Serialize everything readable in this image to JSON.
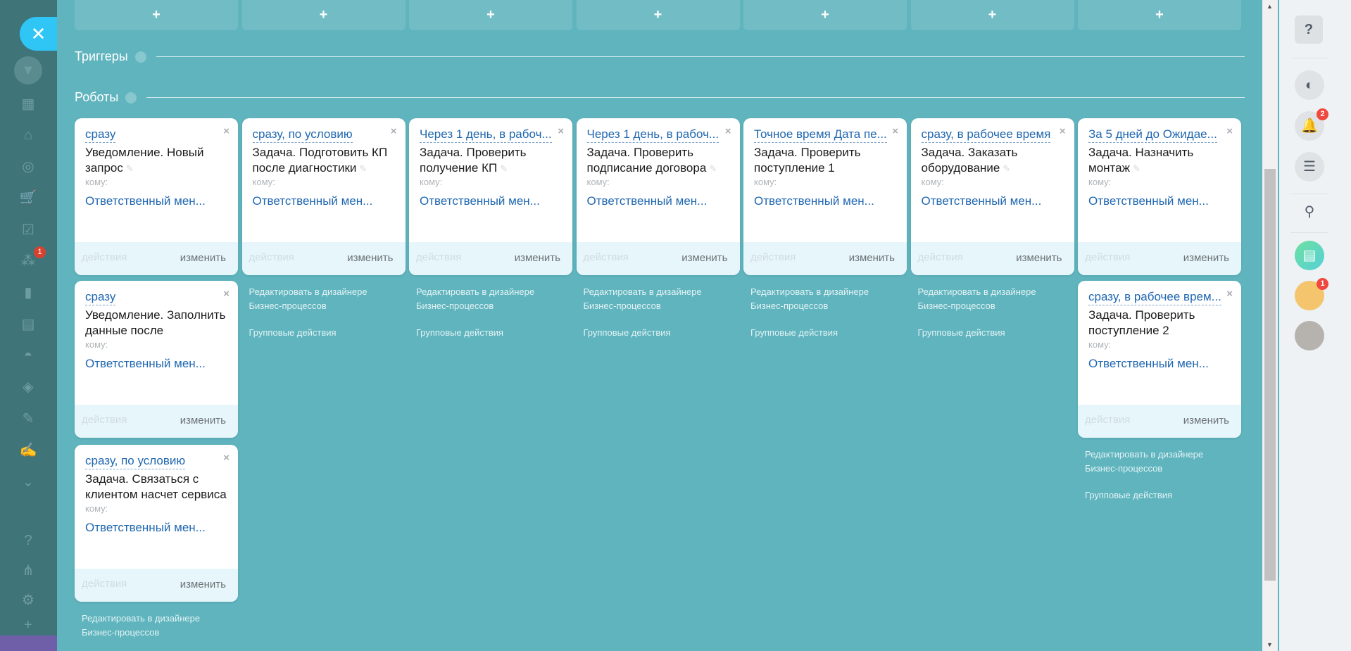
{
  "sidebar": {
    "close_label": "✕",
    "items": [
      {
        "icon": "filter-icon",
        "glyph": "▼",
        "active": true
      },
      {
        "icon": "calendar-list-icon",
        "glyph": "▦"
      },
      {
        "icon": "warehouse-icon",
        "glyph": "⌂"
      },
      {
        "icon": "target-icon",
        "glyph": "◎"
      },
      {
        "icon": "cart-icon",
        "glyph": "🛒"
      },
      {
        "icon": "checkbox-icon",
        "glyph": "☑"
      },
      {
        "icon": "network-icon",
        "glyph": "⁂",
        "badge": "1"
      },
      {
        "icon": "chart-icon",
        "glyph": "▮"
      },
      {
        "icon": "contact-card-icon",
        "glyph": "▤"
      },
      {
        "icon": "robot-icon",
        "glyph": "◓"
      },
      {
        "icon": "cube-icon",
        "glyph": "◈"
      },
      {
        "icon": "document-edit-icon",
        "glyph": "✎"
      },
      {
        "icon": "signature-icon",
        "glyph": "✍"
      },
      {
        "icon": "chevron-down-circle-icon",
        "glyph": "⌄"
      },
      {
        "icon": "help-icon",
        "glyph": "?"
      },
      {
        "icon": "sitemap-icon",
        "glyph": "⋔"
      },
      {
        "icon": "gear-icon",
        "glyph": "⚙"
      },
      {
        "icon": "plus-icon",
        "glyph": "+"
      }
    ]
  },
  "add_tiles": [
    "+",
    "+",
    "+",
    "+",
    "+",
    "+",
    "+"
  ],
  "sections": {
    "triggers": "Триггеры",
    "robots": "Роботы",
    "help": "?"
  },
  "card_labels": {
    "to": "кому:",
    "actions": "действия",
    "change": "изменить",
    "close": "×",
    "pen": "✎"
  },
  "column_links": {
    "edit_line1": "Редактировать в дизайнере",
    "edit_line2": "Бизнес-процессов",
    "group": "Групповые действия"
  },
  "columns": [
    {
      "robots": [
        {
          "condition": "сразу",
          "title": "Уведомление. Новый запрос",
          "pen": true,
          "responsible": "Ответственный мен..."
        },
        {
          "condition": "сразу",
          "title": "Уведомление. Заполнить данные после",
          "pen": false,
          "responsible": "Ответственный мен..."
        },
        {
          "condition": "сразу, по условию",
          "title": "Задача. Связаться с клиентом насчет сервиса",
          "pen": false,
          "responsible": "Ответственный мен..."
        }
      ],
      "links_group": false
    },
    {
      "robots": [
        {
          "condition": "сразу, по условию",
          "title": "Задача. Подготовить КП после диагностики",
          "pen": true,
          "responsible": "Ответственный мен..."
        }
      ],
      "links_group": true
    },
    {
      "robots": [
        {
          "condition": "Через 1 день, в рабоч...",
          "title": "Задача. Проверить получение КП",
          "pen": true,
          "responsible": "Ответственный мен..."
        }
      ],
      "links_group": true
    },
    {
      "robots": [
        {
          "condition": "Через 1 день, в рабоч...",
          "title": "Задача. Проверить подписание договора",
          "pen": true,
          "responsible": "Ответственный мен..."
        }
      ],
      "links_group": true
    },
    {
      "robots": [
        {
          "condition": "Точное время Дата пе...",
          "title": "Задача. Проверить поступление 1",
          "pen": false,
          "responsible": "Ответственный мен..."
        }
      ],
      "links_group": true
    },
    {
      "robots": [
        {
          "condition": "сразу, в рабочее время",
          "title": "Задача. Заказать оборудование",
          "pen": true,
          "responsible": "Ответственный мен..."
        }
      ],
      "links_group": true
    },
    {
      "robots": [
        {
          "condition": "За 5 дней до Ожидае...",
          "title": "Задача. Назначить монтаж",
          "pen": true,
          "responsible": "Ответственный мен..."
        },
        {
          "condition": "сразу, в рабочее врем...",
          "title": "Задача. Проверить поступление 2",
          "pen": false,
          "responsible": "Ответственный мен..."
        }
      ],
      "links_group": true
    }
  ],
  "right_panel": {
    "help": "?",
    "items": [
      {
        "icon": "copilot-icon",
        "glyph": "◐"
      },
      {
        "icon": "bell-icon",
        "glyph": "🔔",
        "badge": "2"
      },
      {
        "icon": "chat-list-icon",
        "glyph": "☰"
      }
    ],
    "search": "⚲",
    "avatar_badge": "1"
  },
  "colors": {
    "background": "#5fb4be",
    "link_blue": "#2067b0",
    "sidebar": "#3f7479"
  }
}
